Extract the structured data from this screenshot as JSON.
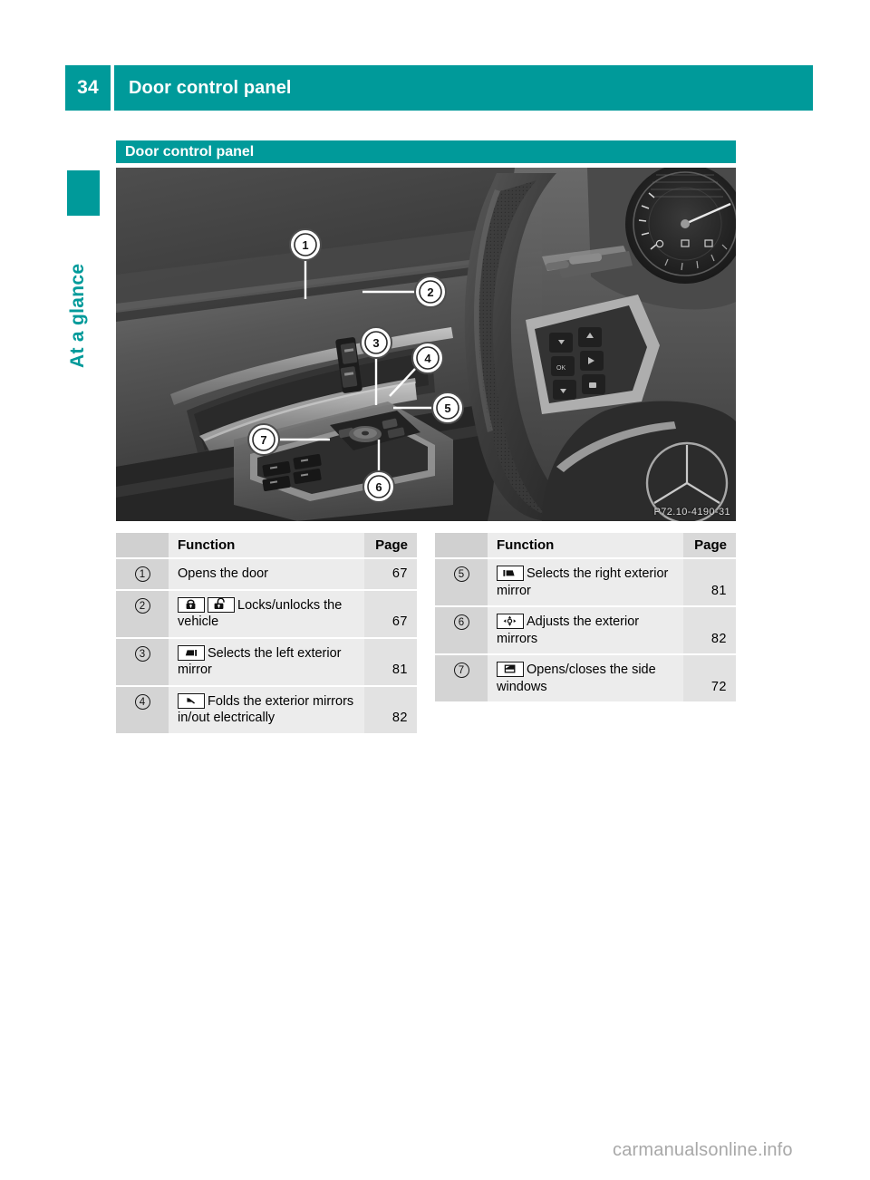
{
  "header": {
    "page_number": "34",
    "title": "Door control panel"
  },
  "sidebar": {
    "chapter_label": "At a glance"
  },
  "section": {
    "title": "Door control panel"
  },
  "photo": {
    "credit": "P72.10-4190-31",
    "callouts": [
      "1",
      "2",
      "3",
      "4",
      "5",
      "6",
      "7"
    ],
    "alt": "Driver door control panel with steering wheel and instrument cluster"
  },
  "tables": {
    "left": {
      "columns": {
        "function": "Function",
        "page": "Page"
      },
      "rows": [
        {
          "marker": "1",
          "icons": [],
          "text": "Opens the door",
          "page": "67"
        },
        {
          "marker": "2",
          "icons": [
            "lock-closed-icon",
            "lock-open-icon"
          ],
          "text": "Locks/unlocks the vehicle",
          "page": "67"
        },
        {
          "marker": "3",
          "icons": [
            "left-exterior-mirror-icon"
          ],
          "text": "Selects the left exterior mirror",
          "page": "81"
        },
        {
          "marker": "4",
          "icons": [
            "fold-mirrors-icon"
          ],
          "text": "Folds the exterior mirrors in/out electrically",
          "page": "82"
        }
      ]
    },
    "right": {
      "columns": {
        "function": "Function",
        "page": "Page"
      },
      "rows": [
        {
          "marker": "5",
          "icons": [
            "right-exterior-mirror-icon"
          ],
          "text": "Selects the right exterior mirror",
          "page": "81"
        },
        {
          "marker": "6",
          "icons": [
            "adjust-mirrors-icon"
          ],
          "text": "Adjusts the exterior mirrors",
          "page": "82"
        },
        {
          "marker": "7",
          "icons": [
            "side-window-icon"
          ],
          "text": "Opens/closes the side windows",
          "page": "72"
        }
      ]
    }
  },
  "watermark": {
    "text": "carmanualsonline.info"
  },
  "colors": {
    "brand_teal": "#009a9a",
    "header_text": "#ffffff",
    "table_marker_bg": "#d4d4d4",
    "table_func_bg": "#ececec",
    "table_page_bg": "#e2e2e2"
  }
}
